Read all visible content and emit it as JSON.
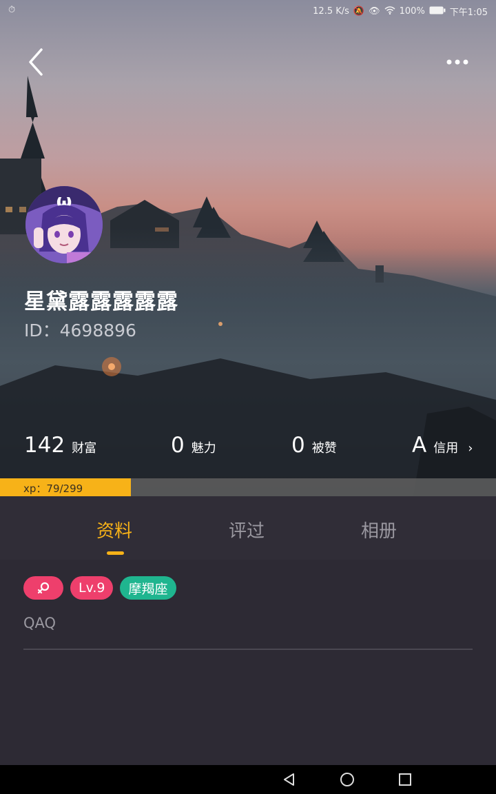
{
  "status_bar": {
    "left_icon": "alarm-icon",
    "speed": "12.5 K/s",
    "battery": "100%",
    "time": "下午1:05"
  },
  "profile": {
    "username": "星黛露露露露露",
    "id_label": "ID：",
    "id_value": "4698896"
  },
  "stats": [
    {
      "value": "142",
      "label": "财富"
    },
    {
      "value": "0",
      "label": "魅力"
    },
    {
      "value": "0",
      "label": "被赞"
    },
    {
      "value": "A",
      "label": "信用",
      "arrow": "›"
    }
  ],
  "xp": {
    "label": "xp：79/299",
    "current": 79,
    "max": 299
  },
  "tabs": [
    {
      "label": "资料",
      "active": true
    },
    {
      "label": "评过",
      "active": false
    },
    {
      "label": "相册",
      "active": false
    }
  ],
  "tags": {
    "gender_icon": "female-symbol-icon",
    "level": "Lv.9",
    "zodiac": "摩羯座"
  },
  "bio": "QAQ",
  "colors": {
    "accent": "#f7b218",
    "tag_pink": "#ee3f6c",
    "tag_green": "#1fb58f",
    "background": "#2d2a34"
  }
}
